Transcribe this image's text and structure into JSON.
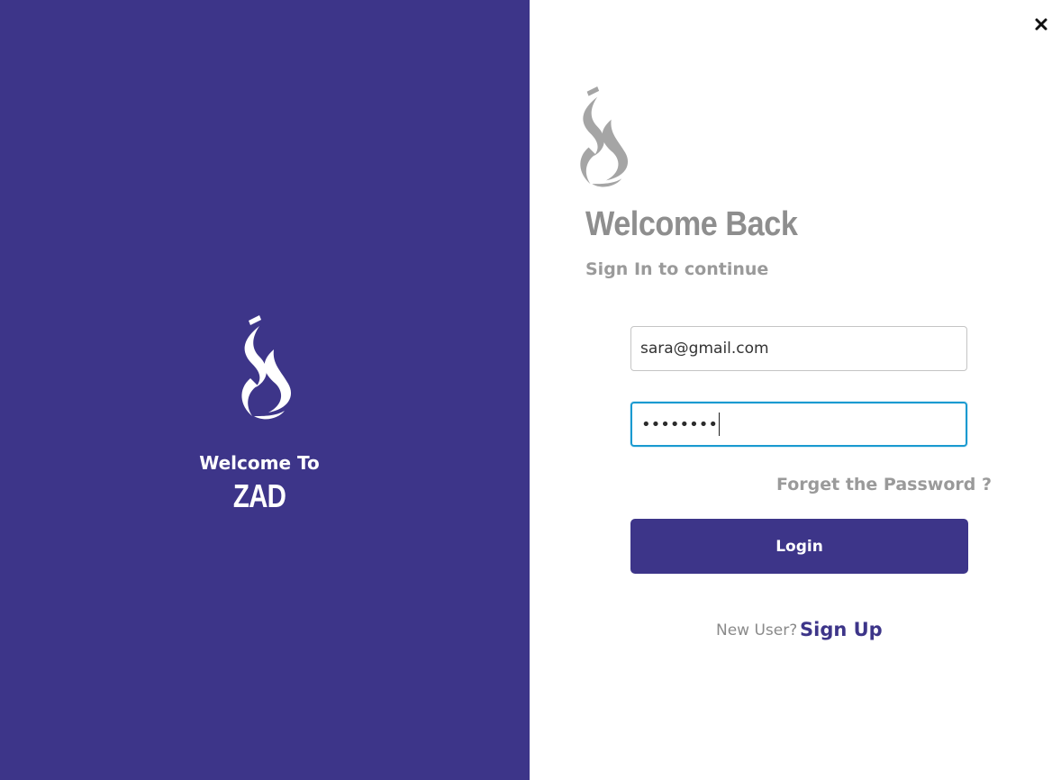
{
  "window": {
    "close_icon": "close-icon"
  },
  "brand_panel": {
    "logo_icon": "zad-logo-flame",
    "welcome_text": "Welcome To",
    "brand_name": "ZAD",
    "background_color": "#3d3589"
  },
  "login_panel": {
    "logo_icon": "zad-logo-flame-grey",
    "title": "Welcome Back",
    "subtitle": "Sign In to continue",
    "email": {
      "value": "sara@gmail.com"
    },
    "password": {
      "masked_value": "••••••••"
    },
    "forgot_password_label": "Forget the Password ?",
    "login_button_label": "Login",
    "new_user_text": "New User?",
    "sign_up_label": "Sign Up"
  },
  "colors": {
    "accent": "#3d3589",
    "muted_text": "#9a9a9a",
    "focus_border": "#1a9ad0"
  }
}
